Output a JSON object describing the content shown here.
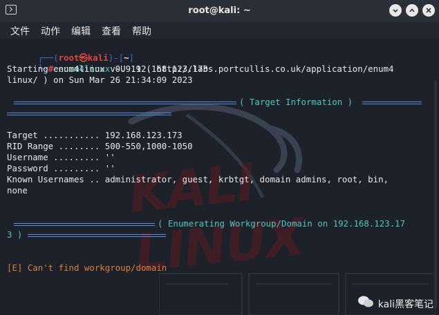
{
  "window": {
    "title": "root@kali: ~"
  },
  "menu": [
    "文件",
    "动作",
    "编辑",
    "查看",
    "帮助"
  ],
  "prompt": {
    "open": "┌──(",
    "user": "root㉿kali",
    "mid": ")-[",
    "dir": "~",
    "close": "]",
    "hash_prefix": "└─",
    "hash": "#",
    "command": "enum4linux",
    "args": " -U 192.168.123.173"
  },
  "output": {
    "start1": "Starting enum4linux v0.9.1 ( http://labs.portcullis.co.uk/application/enum4",
    "start2": "linux/ ) on Sun Mar 26 21:34:09 2023",
    "section1": "( Target Information )",
    "target": "Target ........... 192.168.123.173",
    "rid": "RID Range ........ 500-550,1000-1050",
    "username": "Username ......... ''",
    "password": "Password ......... ''",
    "known1": "Known Usernames .. administrator, guest, krbtgt, domain admins, root, bin,",
    "known2": "none",
    "section2a": "( Enumerating Workgroup/Domain on 192.168.123.17",
    "section2b": "3 )",
    "error": "[E] Can't find workgroup/domain"
  },
  "background": {
    "logo_text": "KALI LINUX"
  },
  "watermark": {
    "text": "kali黑客笔记"
  }
}
